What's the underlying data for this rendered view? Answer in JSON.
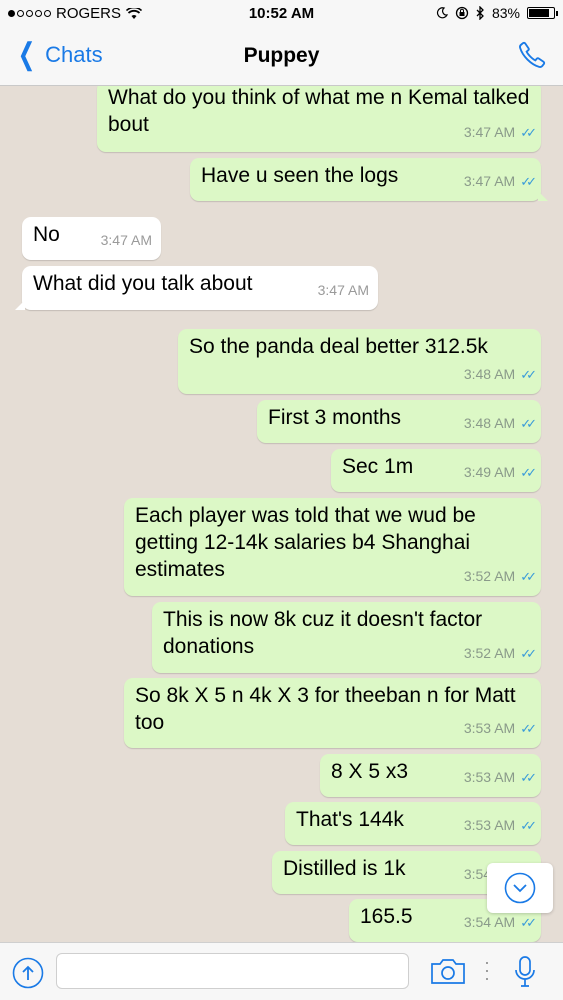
{
  "status_bar": {
    "carrier": "ROGERS",
    "time": "10:52 AM",
    "battery": "83%",
    "battery_level": 0.83
  },
  "nav": {
    "back_label": "Chats",
    "title": "Puppey"
  },
  "messages": [
    {
      "dir": "out",
      "text": "What do you think of what me n Kemal talked bout",
      "time": "3:47 AM"
    },
    {
      "dir": "out",
      "text": "Have u seen the logs",
      "time": "3:47 AM"
    },
    {
      "dir": "in",
      "text": "No",
      "time": "3:47 AM"
    },
    {
      "dir": "in",
      "text": "What did you talk about",
      "time": "3:47 AM"
    },
    {
      "dir": "out",
      "text": "So the panda deal better 312.5k",
      "time": "3:48 AM"
    },
    {
      "dir": "out",
      "text": "First 3 months",
      "time": "3:48 AM"
    },
    {
      "dir": "out",
      "text": "Sec 1m",
      "time": "3:49 AM"
    },
    {
      "dir": "out",
      "text": "Each player was told that we wud be getting 12-14k salaries b4 Shanghai estimates",
      "time": "3:52 AM"
    },
    {
      "dir": "out",
      "text": "This is now 8k cuz it doesn't factor donations",
      "time": "3:52 AM"
    },
    {
      "dir": "out",
      "text": "So 8k X 5 n 4k X 3 for theeban n for Matt too",
      "time": "3:53 AM"
    },
    {
      "dir": "out",
      "text": "8 X 5 x3",
      "time": "3:53 AM"
    },
    {
      "dir": "out",
      "text": "That's 144k",
      "time": "3:53 AM"
    },
    {
      "dir": "out",
      "text": "Distilled is 1k",
      "time": "3:54 AM"
    },
    {
      "dir": "out",
      "text": "165.5",
      "time": "3:54 AM"
    }
  ],
  "input": {
    "placeholder": ""
  },
  "icons": {
    "back": "chevron-left-icon",
    "call": "phone-icon",
    "scroll": "chevron-down-circle-icon",
    "attach": "upload-icon",
    "camera": "camera-icon",
    "mic": "microphone-icon"
  },
  "colors": {
    "accent": "#1a7ae6",
    "outgoing_bubble": "#dcf8c6",
    "incoming_bubble": "#ffffff",
    "read_ticks": "#3a9bd9",
    "chat_bg": "#e5ddd5"
  }
}
